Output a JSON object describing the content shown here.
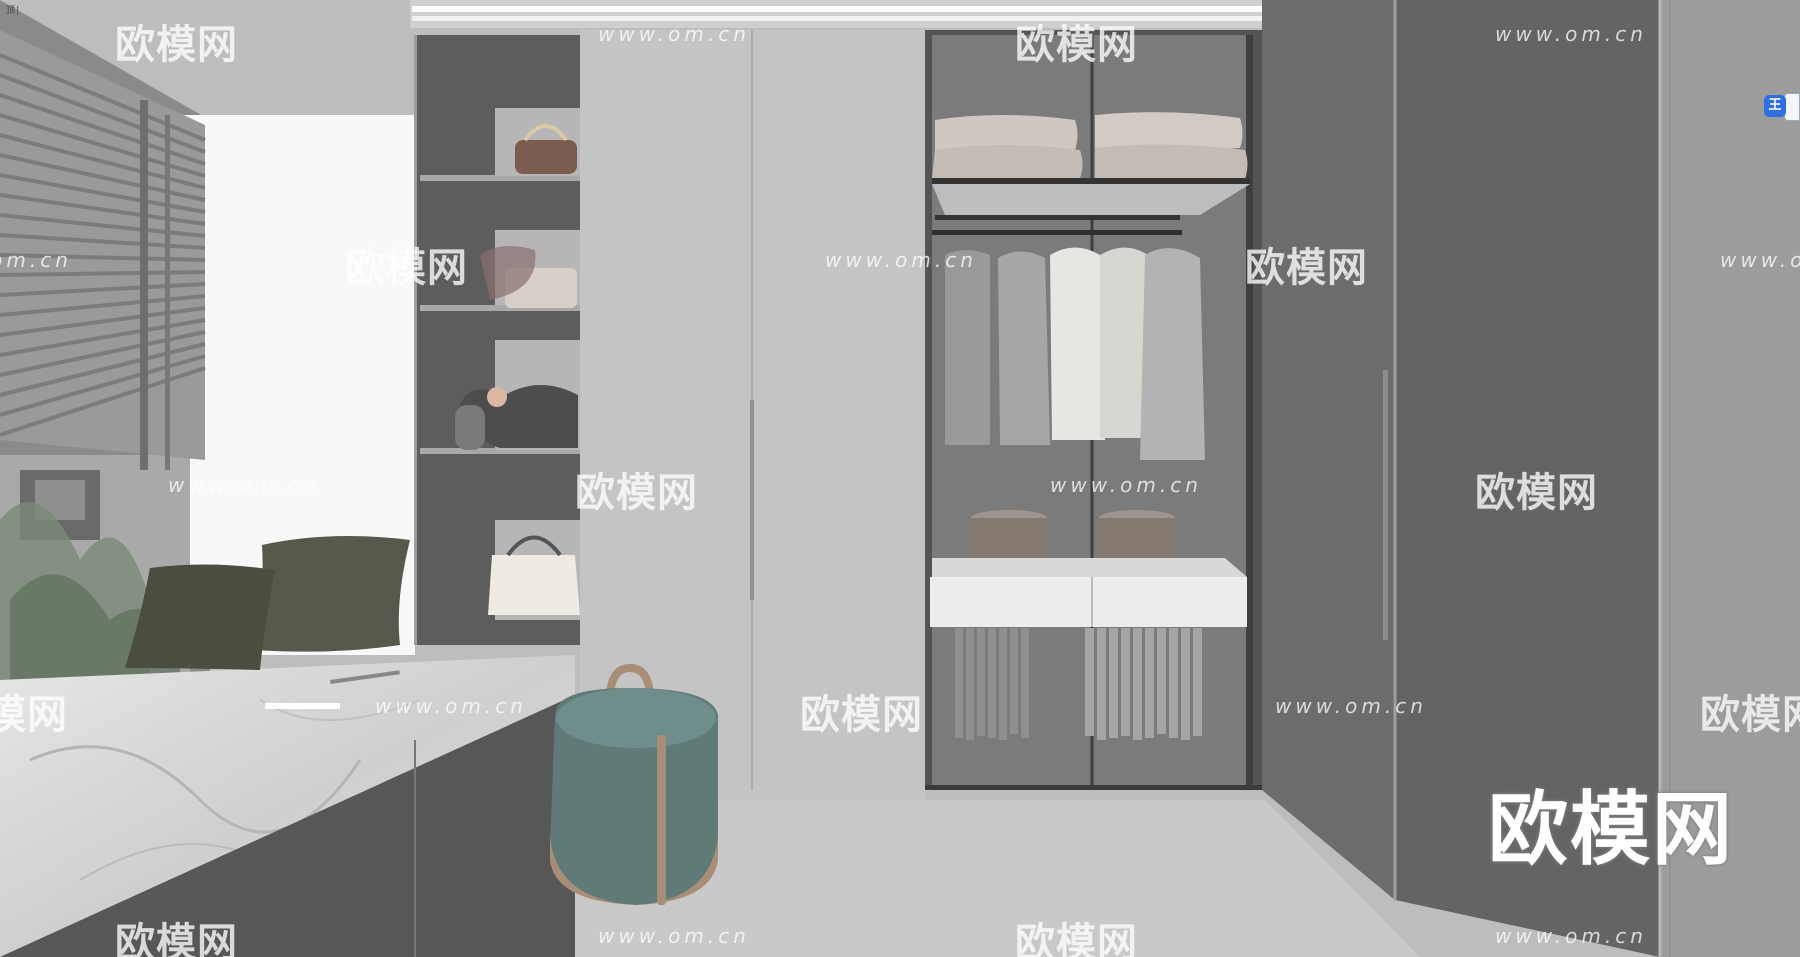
{
  "corner_label": "顶|",
  "badge_icon": "王",
  "watermark": {
    "logo_text": "欧模网",
    "url_text": "www.om.cn",
    "big_text": "欧模网"
  },
  "colors": {
    "wall": "#bdbdbd",
    "cabinet_dark": "#6b6b6b",
    "window_light": "#f8f8f8",
    "stool_teal": "#5f7a77",
    "stool_leather": "#a88d77",
    "badge_blue": "#2f6fe0"
  }
}
